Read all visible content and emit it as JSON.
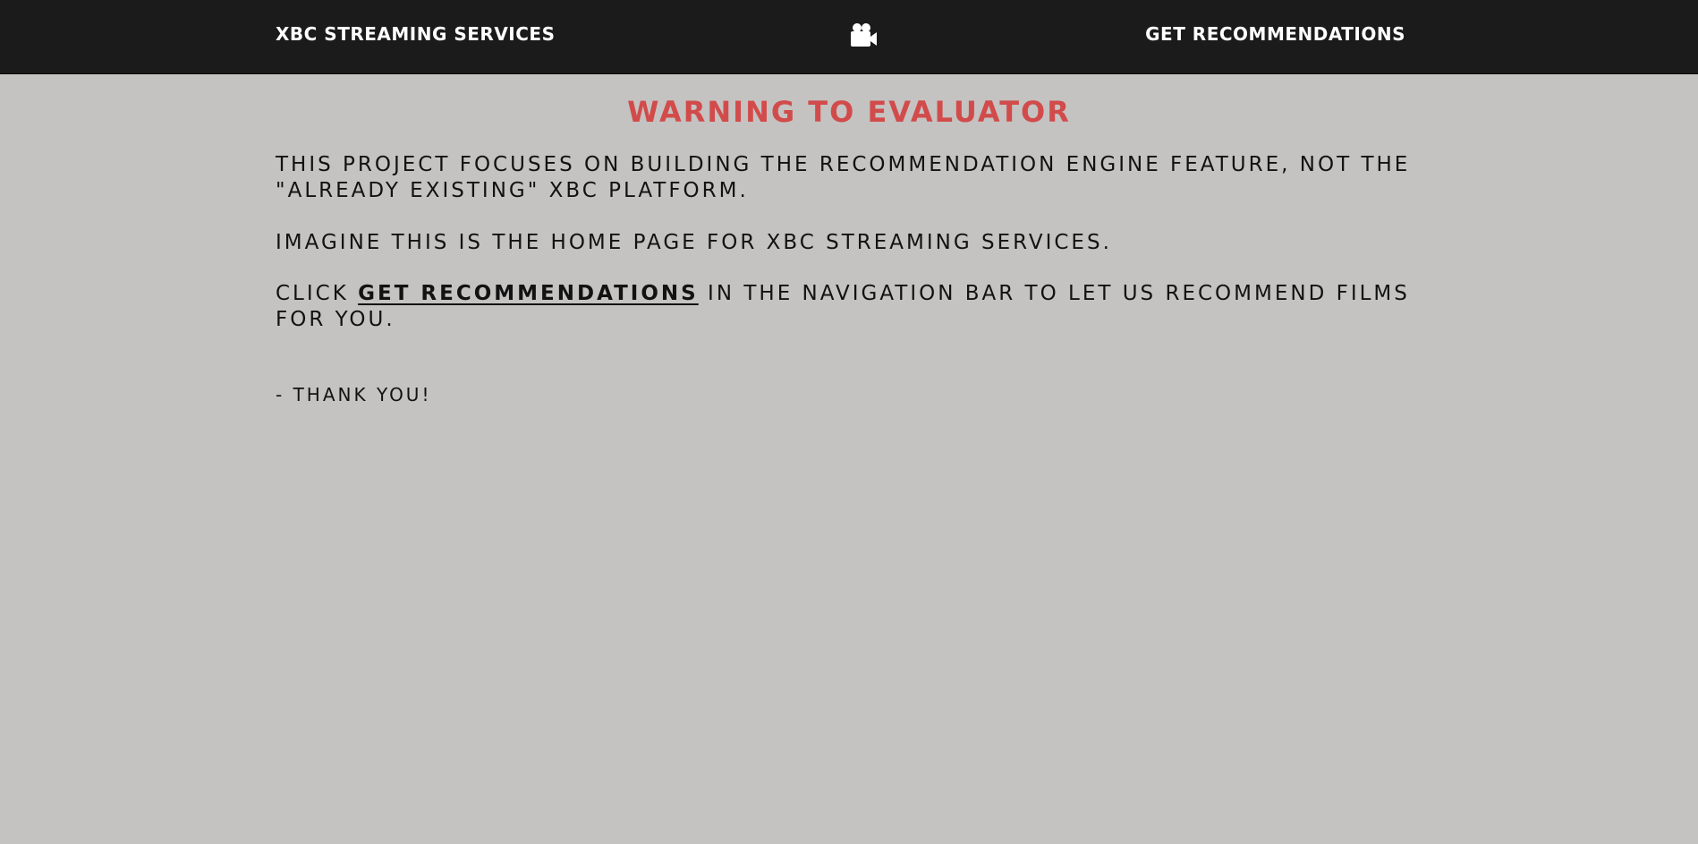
{
  "navbar": {
    "brand_label": "XBC STREAMING SERVICES",
    "logo_icon": "video-camera-icon",
    "recommend_label": "GET RECOMMENDATIONS",
    "background": "#1b1b1b",
    "text_color": "#ffffff"
  },
  "main": {
    "heading": "WARNING TO EVALUATOR",
    "heading_color": "#d24b4b",
    "paragraph_1": "THIS PROJECT FOCUSES ON BUILDING THE RECOMMENDATION ENGINE FEATURE, NOT THE \"ALREADY EXISTING\" XBC PLATFORM.",
    "paragraph_2": "IMAGINE THIS IS THE HOME PAGE FOR XBC STREAMING SERVICES.",
    "paragraph_3": {
      "prefix": "CLICK ",
      "link_label": "GET RECOMMENDATIONS",
      "suffix": " IN THE NAVIGATION BAR TO LET US RECOMMEND FILMS FOR YOU."
    },
    "signoff": "- THANK YOU!"
  },
  "page_background": "#c4c3c1"
}
